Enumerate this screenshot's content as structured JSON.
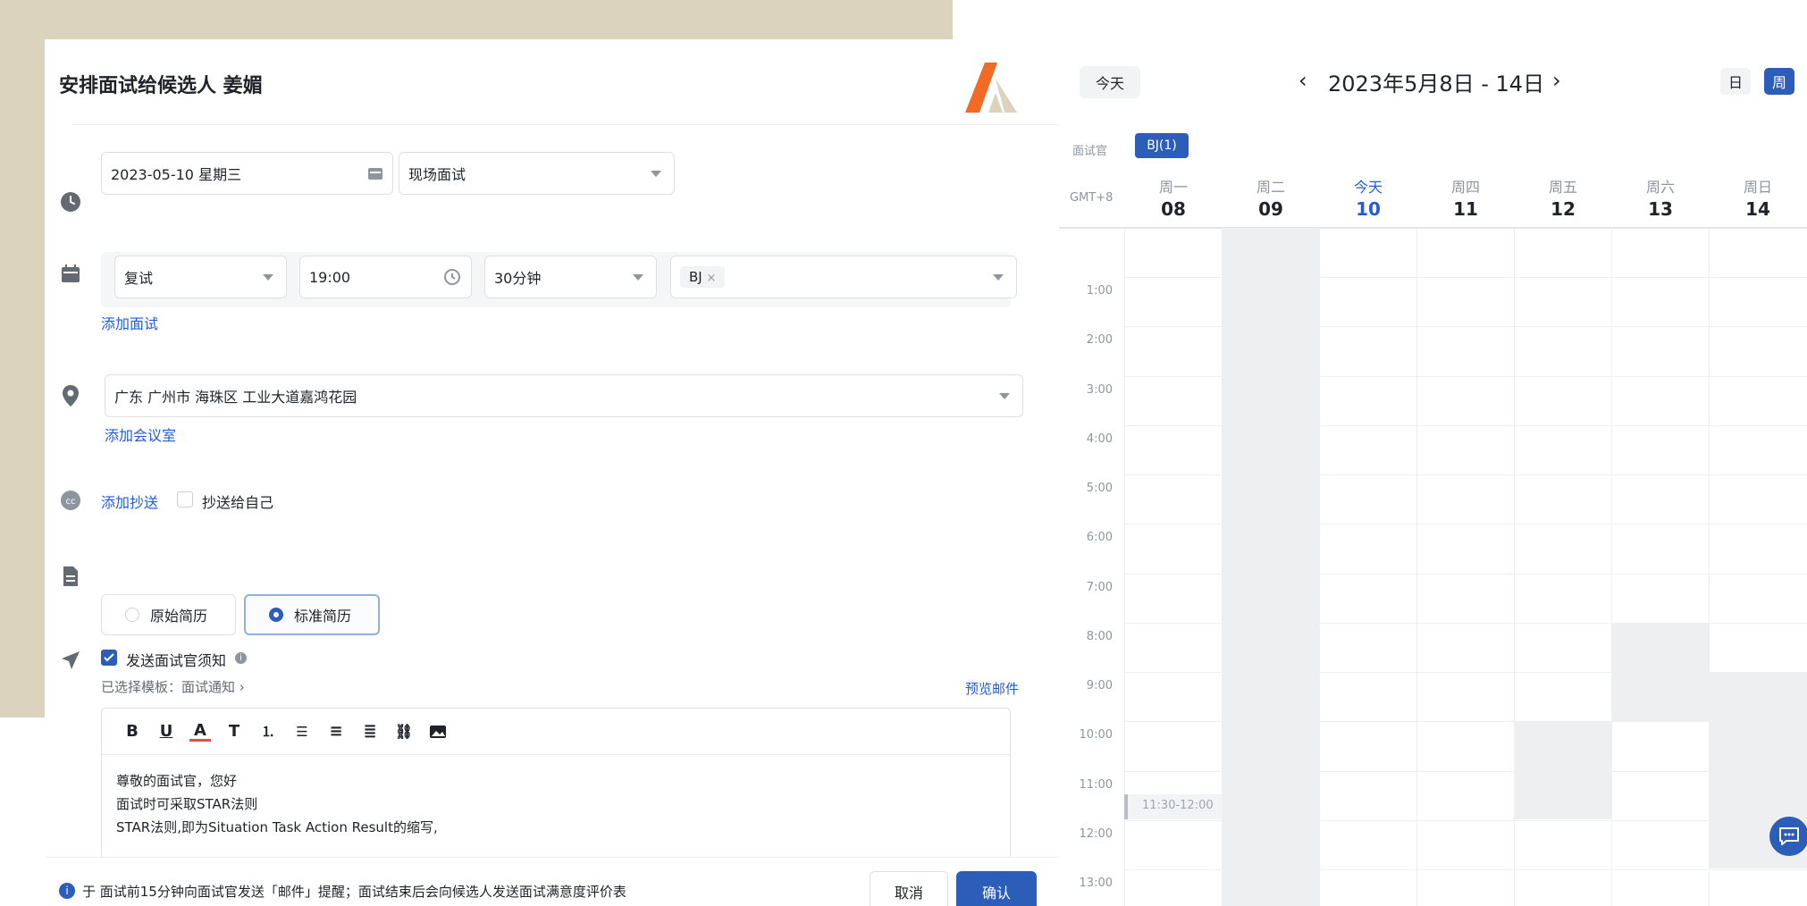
{
  "dialog": {
    "title": "安排面试给候选人 姜媚",
    "date": "2023-05-10 星期三",
    "mode": "现场面试",
    "round": "复试",
    "time": "19:00",
    "duration": "30分钟",
    "interviewer_tag": "BJ",
    "add_interview": "添加面试",
    "location": "广东 广州市 海珠区 工业大道嘉鸿花园",
    "add_room": "添加会议室",
    "add_cc": "添加抄送",
    "cc_self": "抄送给自己",
    "resume_original": "原始简历",
    "resume_standard": "标准简历",
    "send_notice": "发送面试官须知",
    "template_label": "已选择模板：面试通知",
    "preview_mail": "预览邮件",
    "editor_lines": [
      "尊敬的面试官，您好",
      "面试时可采取STAR法则",
      "STAR法则,即为Situation Task Action Result的缩写,"
    ],
    "footer_note": "于 面试前15分钟向面试官发送「邮件」提醒；面试结束后会向候选人发送面试满意度评价表",
    "cancel": "取消",
    "confirm": "确认"
  },
  "calendar": {
    "today_button": "今天",
    "range": "2023年5月8日 - 14日",
    "view_day": "日",
    "view_week": "周",
    "interviewer_label": "面试官",
    "interviewer_chip": "BJ(1)",
    "timezone": "GMT+8",
    "days": [
      {
        "name": "周一",
        "date": "08"
      },
      {
        "name": "周二",
        "date": "09"
      },
      {
        "name": "今天",
        "date": "10"
      },
      {
        "name": "周四",
        "date": "11"
      },
      {
        "name": "周五",
        "date": "12"
      },
      {
        "name": "周六",
        "date": "13"
      },
      {
        "name": "周日",
        "date": "14"
      }
    ],
    "hours": [
      "1:00",
      "2:00",
      "3:00",
      "4:00",
      "5:00",
      "6:00",
      "7:00",
      "8:00",
      "9:00",
      "10:00",
      "11:00",
      "12:00",
      "13:00"
    ],
    "event": "11:30-12:00"
  },
  "colors": {
    "accent": "#2b5db9",
    "link": "#245bdb",
    "beige": "#dbd3bd"
  }
}
